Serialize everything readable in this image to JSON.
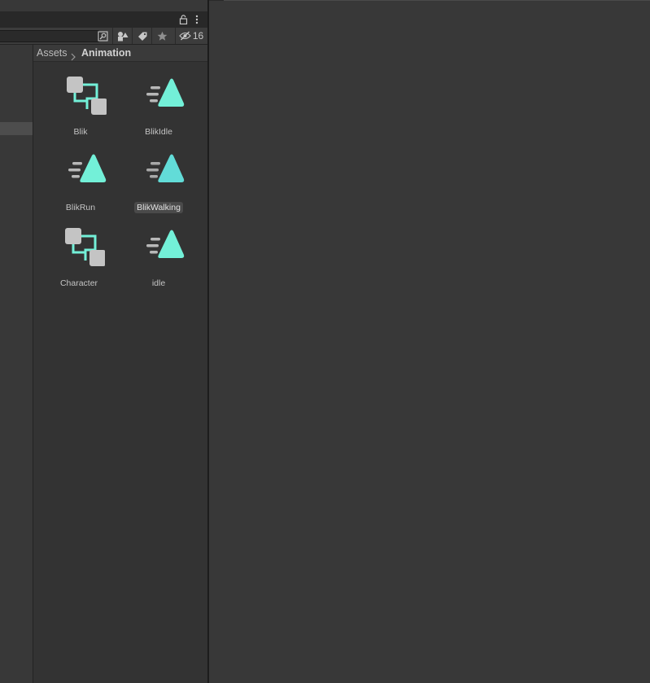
{
  "project": {
    "search": {
      "value": "",
      "placeholder": ""
    },
    "hidden_count": "16",
    "breadcrumb": {
      "root": "Assets",
      "current": "Animation"
    },
    "assets": [
      {
        "name": "Blik",
        "type": "animator-controller",
        "selected": false
      },
      {
        "name": "BlikIdle",
        "type": "animation-clip",
        "selected": false
      },
      {
        "name": "BlikRun",
        "type": "animation-clip",
        "selected": false
      },
      {
        "name": "BlikWalking",
        "type": "animation-clip",
        "selected": true
      },
      {
        "name": "Character",
        "type": "animator-controller",
        "selected": false
      },
      {
        "name": "idle",
        "type": "animation-clip",
        "selected": false
      }
    ]
  },
  "icons": {
    "tab_lock": "lock-icon",
    "tab_menu": "kebab-menu-icon",
    "search_toggle": "search-by-type-icon",
    "filter_type": "filter-by-type-icon",
    "filter_label": "filter-by-label-icon",
    "favorites": "star-icon",
    "hidden_packages": "eye-slash-icon"
  },
  "colors": {
    "accent": "#73f0d8",
    "node_gray": "#c4c4c4",
    "panel_bg": "#383838",
    "content_bg": "#333333"
  }
}
